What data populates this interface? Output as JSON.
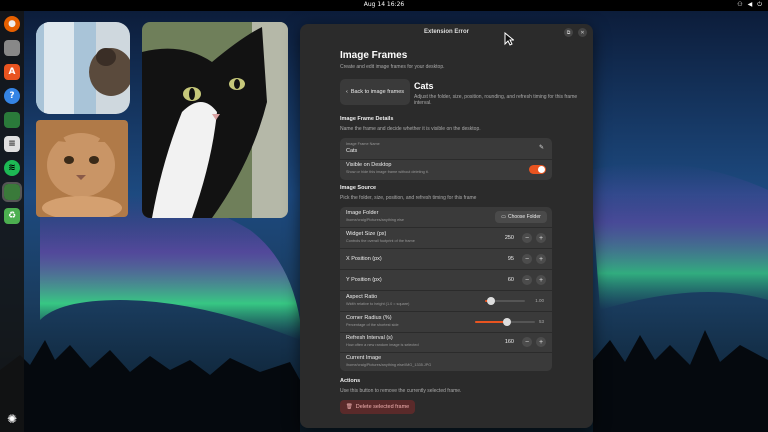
{
  "topbar": {
    "datetime": "Aug 14  16:26",
    "tray_icons": [
      "network-icon",
      "volume-icon",
      "power-icon"
    ]
  },
  "dock": {
    "apps": [
      {
        "name": "firefox-icon",
        "color": "#e66000"
      },
      {
        "name": "files-icon",
        "color": "#888888"
      },
      {
        "name": "app-center-icon",
        "color": "#e95420"
      },
      {
        "name": "help-icon",
        "color": "#3584e4"
      },
      {
        "name": "app-icon",
        "color": "#2a7a3a"
      },
      {
        "name": "text-editor-icon",
        "color": "#e0e0e0"
      },
      {
        "name": "spotify-icon",
        "color": "#1db954"
      },
      {
        "name": "extension-app-icon",
        "color": "#3a7a3a"
      },
      {
        "name": "trash-icon",
        "color": "#4caf50"
      }
    ],
    "ubuntu_logo": "ubuntu-logo-icon"
  },
  "dialog": {
    "window_title": "Extension Error",
    "heading": "Image Frames",
    "subtitle": "Create and edit image frames for your desktop.",
    "back_button": "Back to image frames",
    "frame_title": "Cats",
    "frame_subtitle": "Adjust the folder, size, position, rounding, and refresh timing for this frame",
    "frame_subtitle_line2": "interval.",
    "details_section": {
      "title": "Image Frame Details",
      "subtitle": "Name the frame and decide whether it is visible on the desktop.",
      "name_label": "Image Frame Name",
      "name_value": "Cats",
      "visible_label": "Visible on Desktop",
      "visible_hint": "Show or hide this image frame without deleting it.",
      "visible": true
    },
    "source_section": {
      "title": "Image Source",
      "subtitle": "Pick the folder, size, position, and refresh timing for this frame",
      "folder_label": "Image Folder",
      "folder_path": "/home/craig/Pictures/anything else",
      "choose_button": "Choose Folder",
      "widget_label": "Widget Size (px)",
      "widget_hint": "Controls the overall footprint of the frame",
      "widget_value": "250",
      "xpos_label": "X Position (px)",
      "xpos_value": "95",
      "ypos_label": "Y Position (px)",
      "ypos_value": "60",
      "aspect_label": "Aspect Ratio",
      "aspect_hint": "Width relative to height (1.0 = square)",
      "aspect_value": "1.00",
      "aspect_level": 0.15,
      "radius_label": "Corner Radius (%)",
      "radius_hint": "Percentage of the shortest side",
      "radius_value": "53",
      "radius_level": 0.53,
      "refresh_label": "Refresh Interval (s)",
      "refresh_hint": "How often a new random image is selected",
      "refresh_value": "160",
      "current_label": "Current Image",
      "current_path": "/home/craig/Pictures/anything else/IMG_1335.JPG",
      "minus": "−",
      "plus": "+"
    },
    "actions_section": {
      "title": "Actions",
      "subtitle": "Use this button to remove the currently selected frame.",
      "delete_button": "Delete selected frame"
    }
  },
  "colors": {
    "accent": "#e95420",
    "dialog_bg": "#2b2b2b",
    "card_bg": "#3a3a3a"
  }
}
